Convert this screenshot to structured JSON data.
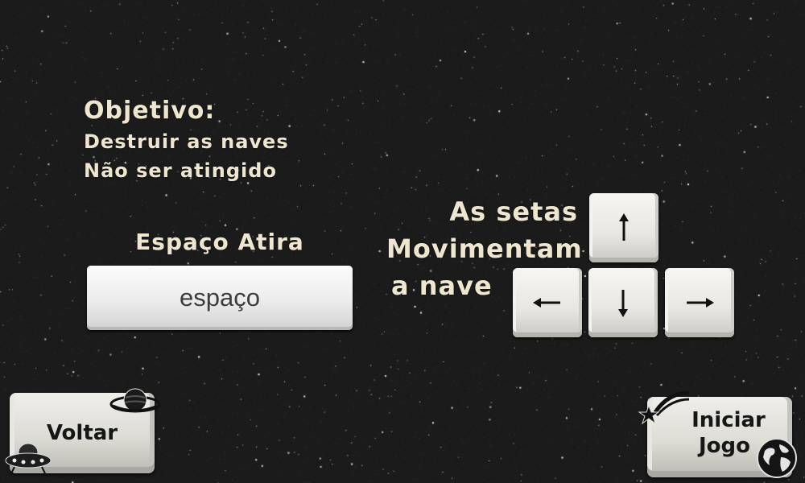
{
  "objective": {
    "title": "Objetivo:",
    "line1": "Destruir as naves",
    "line2": "Não ser atingido"
  },
  "space": {
    "label": "Espaço Atira",
    "key_label": "espaço"
  },
  "arrows": {
    "line1": "As setas",
    "line2": "Movimentam",
    "line3": "a nave"
  },
  "buttons": {
    "back_label": "Voltar",
    "start_label_line1": "Iniciar",
    "start_label_line2": "Jogo"
  },
  "icons": {
    "back_top": "planet-icon",
    "back_bottom": "ufo-icon",
    "start_top": "shooting-star-icon",
    "start_bottom": "globe-icon",
    "keys": [
      "arrow-up-icon",
      "arrow-left-icon",
      "arrow-down-icon",
      "arrow-right-icon"
    ]
  },
  "colors": {
    "background": "#1b1b1b",
    "text": "#efe6cf",
    "key_face": "#ececec",
    "button_text": "#161616"
  }
}
